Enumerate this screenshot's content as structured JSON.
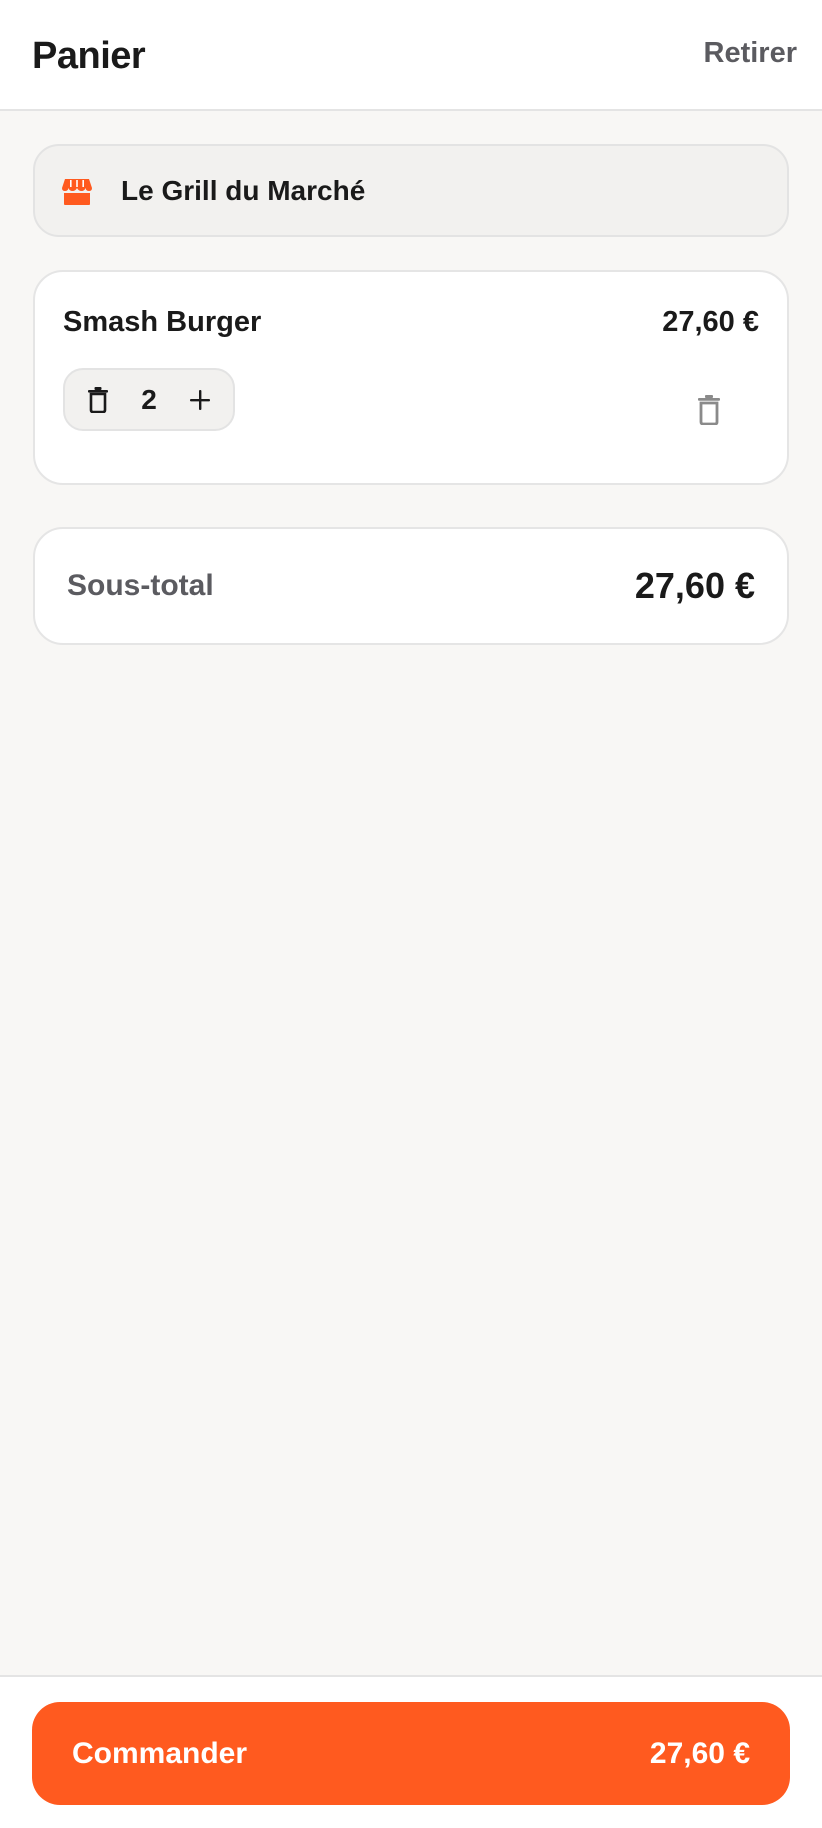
{
  "header": {
    "title": "Panier",
    "clear_label": "Retirer"
  },
  "restaurant": {
    "name": "Le Grill du Marché",
    "icon": "store-icon"
  },
  "cart": {
    "items": [
      {
        "name": "Smash Burger",
        "price": "27,60 €",
        "quantity": "2",
        "decrement_icon": "trash-icon",
        "increment_icon": "plus-icon",
        "remove_icon": "trash-icon"
      }
    ]
  },
  "summary": {
    "subtotal_label": "Sous-total",
    "subtotal_value": "27,60 €"
  },
  "footer": {
    "checkout_label": "Commander",
    "checkout_total": "27,60 €"
  },
  "colors": {
    "accent": "#ff5a1f",
    "background": "#f8f7f5",
    "text": "#1a1a1a",
    "muted_text": "#5b5b60"
  }
}
